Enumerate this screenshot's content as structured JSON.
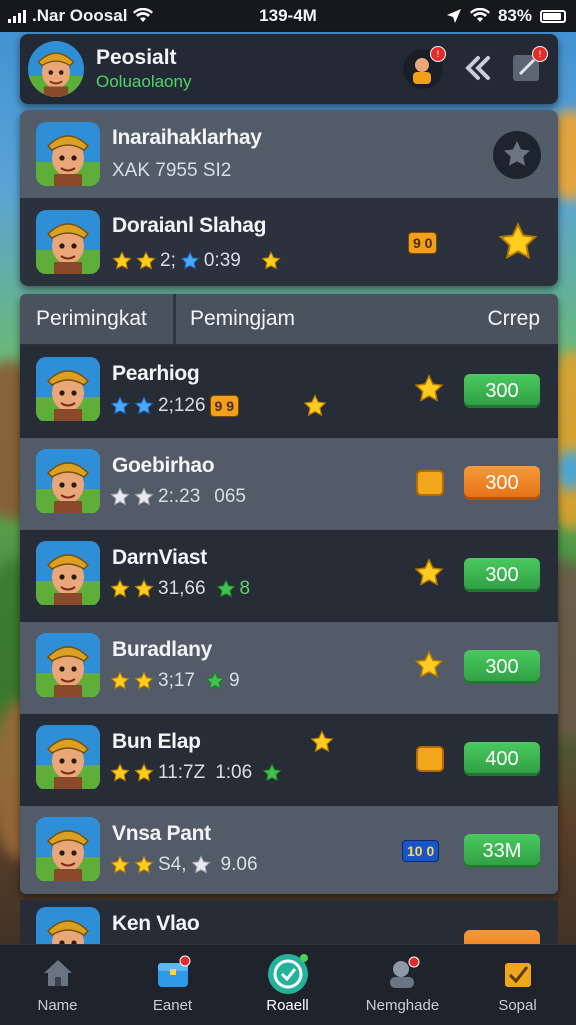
{
  "status": {
    "carrier": ".Nar Ooosal",
    "time": "139-4M",
    "battery": "83%"
  },
  "header": {
    "title": "Peosialt",
    "subtitle": "Ooluaolaony"
  },
  "top_list": [
    {
      "name": "Inaraihaklarhay",
      "meta": "XAK  7955  SI2"
    },
    {
      "name": "Doraianl Slahag",
      "meta": "2;",
      "meta2": "0:39",
      "chip": "9 0"
    }
  ],
  "tabs": {
    "first": "Perimingkat",
    "second": "Pemingjam",
    "third": "Crrep"
  },
  "rows": [
    {
      "name": "Pearhiog",
      "stat": "2;126",
      "chip": "9 9",
      "score": "300",
      "score_color": "green"
    },
    {
      "name": "Goebirhao",
      "stat": "2:.23",
      "extra": "065",
      "score": "300",
      "score_color": "orange"
    },
    {
      "name": "DarnViast",
      "stat": "31,66",
      "extra": "8",
      "score": "300",
      "score_color": "green"
    },
    {
      "name": "Buradlany",
      "stat": "3;17",
      "extra": "9",
      "score": "300",
      "score_color": "green"
    },
    {
      "name": "Bun Elap",
      "stat": "11:7Z",
      "extra": "1:06",
      "score": "400",
      "score_color": "green"
    },
    {
      "name": "Vnsa Pant",
      "stat": "S4,",
      "extra": "9.06",
      "chip": "10 0",
      "score": "33M",
      "score_color": "green"
    }
  ],
  "partial_row": {
    "name": "Ken Vlao"
  },
  "nav": [
    {
      "label": "Name",
      "icon": "home-icon"
    },
    {
      "label": "Eanet",
      "icon": "chest-icon"
    },
    {
      "label": "Roaell",
      "icon": "social-icon"
    },
    {
      "label": "Nemghade",
      "icon": "friends-icon"
    },
    {
      "label": "Sopal",
      "icon": "shop-icon"
    }
  ],
  "colors": {
    "accent_green": "#3fb852",
    "accent_orange": "#f08a2a",
    "panel_dark": "#262d37",
    "panel_light": "#525b67"
  }
}
